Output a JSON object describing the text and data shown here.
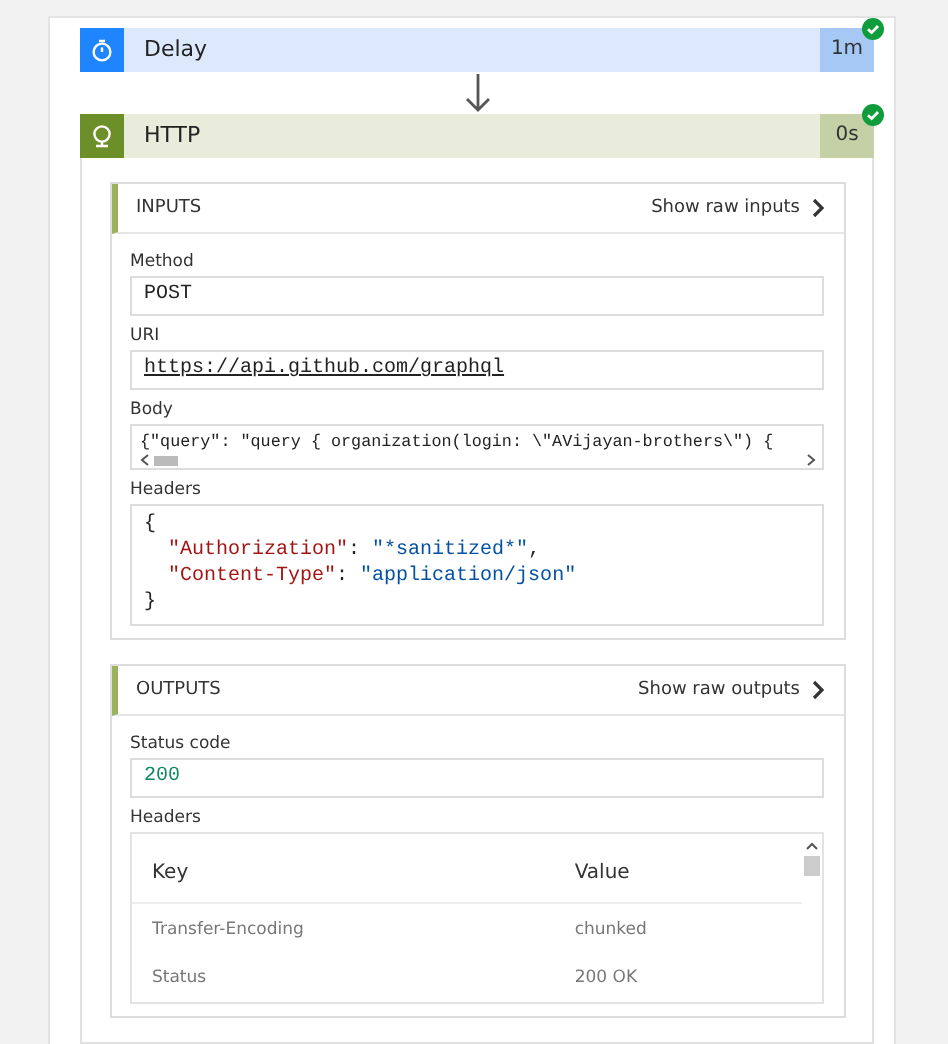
{
  "steps": [
    {
      "title": "Delay",
      "duration": "1m",
      "succeeded": true,
      "kind": "delay"
    },
    {
      "title": "HTTP",
      "duration": "0s",
      "succeeded": true,
      "kind": "http"
    }
  ],
  "inputs": {
    "title": "INPUTS",
    "raw_link": "Show raw inputs",
    "fields": [
      {
        "label": "Method",
        "kind": "text",
        "value": "POST"
      },
      {
        "label": "URI",
        "kind": "link",
        "value": "https://api.github.com/graphql"
      },
      {
        "label": "Body",
        "kind": "scroll",
        "value": "{\"query\": \"query { organization(login: \\\"AVijayan-brothers\\\") {"
      },
      {
        "label": "Headers",
        "kind": "json",
        "open": "{",
        "close": "}",
        "entries": [
          {
            "key": "\"Authorization\"",
            "sep": ":",
            "value": "\"*sanitized*\"",
            "trail": ","
          },
          {
            "key": "\"Content-Type\"",
            "sep": ":",
            "value": "\"application/json\""
          }
        ]
      }
    ]
  },
  "outputs": {
    "title": "OUTPUTS",
    "raw_link": "Show raw outputs",
    "fields": [
      {
        "label": "Status code",
        "kind": "number",
        "value": "200"
      },
      {
        "label": "Headers",
        "kind": "table",
        "columns": [
          "Key",
          "Value"
        ],
        "rows": [
          [
            "Transfer-Encoding",
            "chunked"
          ],
          [
            "Status",
            "200 OK"
          ]
        ]
      }
    ]
  }
}
